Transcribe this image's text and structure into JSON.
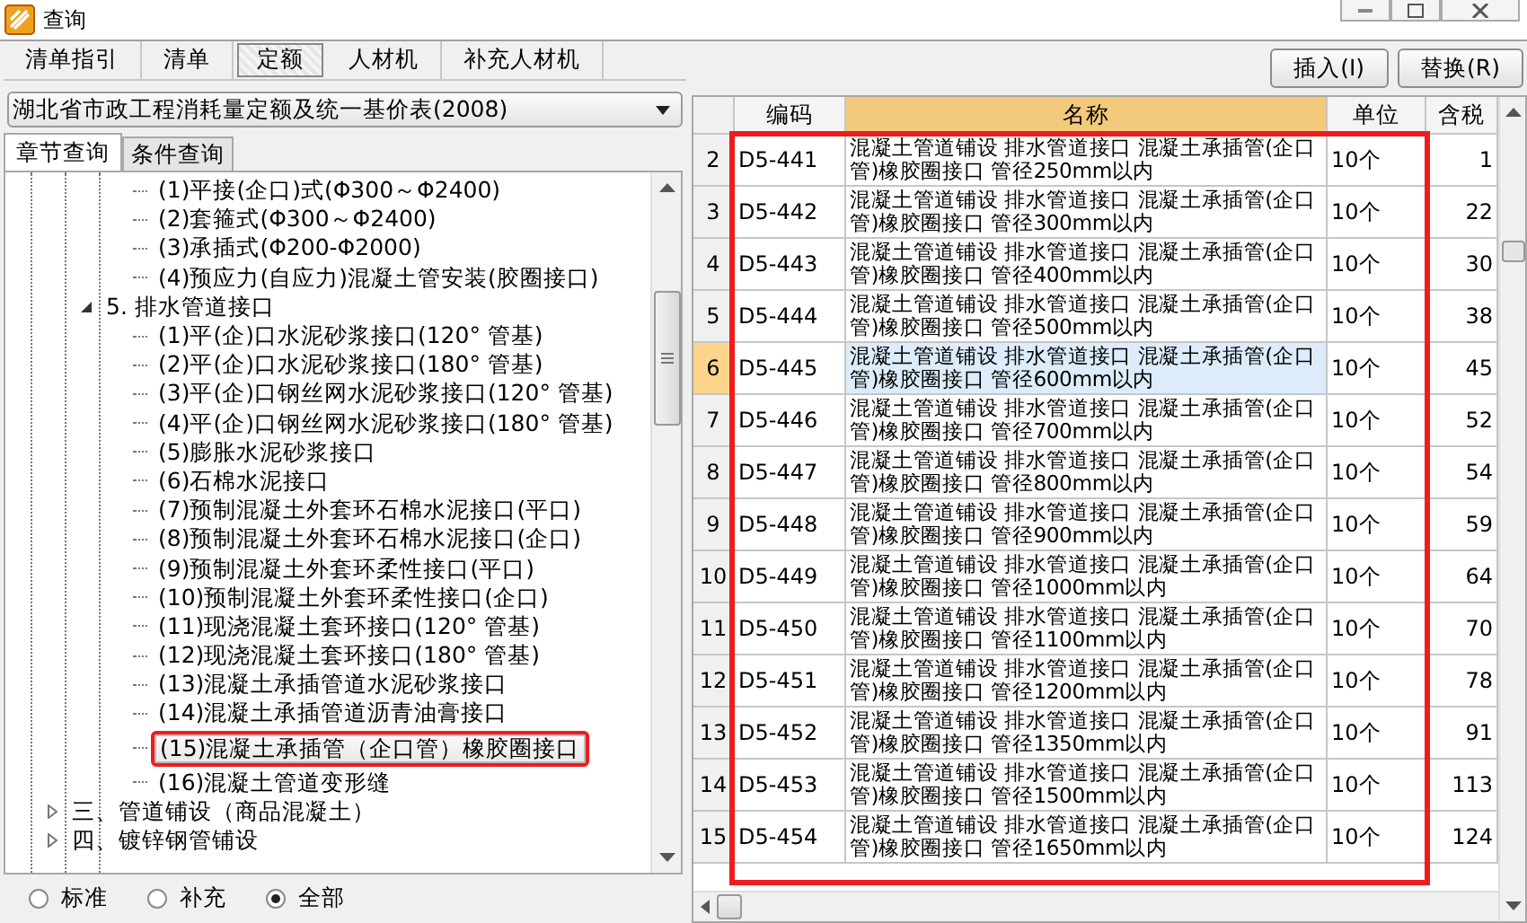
{
  "window": {
    "title": "查询"
  },
  "tabs": [
    {
      "label": "清单指引",
      "selected": false
    },
    {
      "label": "清单",
      "selected": false
    },
    {
      "label": "定额",
      "selected": true
    },
    {
      "label": "人材机",
      "selected": false
    },
    {
      "label": "补充人材机",
      "selected": false
    }
  ],
  "library_dropdown": {
    "value": "湖北省市政工程消耗量定额及统一基价表(2008)"
  },
  "query_tabs": [
    {
      "label": "章节查询",
      "selected": true
    },
    {
      "label": "条件查询",
      "selected": false
    }
  ],
  "tree": [
    {
      "children": [
        {
          "children": [
            {
              "label": "(1)平接(企口)式(Φ300～Φ2400)",
              "highlighted": false,
              "selected": false
            },
            {
              "label": "(2)套箍式(Φ300～Φ2400)",
              "highlighted": false,
              "selected": false
            },
            {
              "label": "(3)承插式(Φ200-Φ2000)",
              "highlighted": false,
              "selected": false
            },
            {
              "label": "(4)预应力(自应力)混凝土管安装(胶圈接口)",
              "highlighted": false,
              "selected": false
            }
          ]
        },
        {
          "label": "5. 排水管道接口",
          "highlighted": false,
          "selected": false,
          "expanded": true,
          "children": [
            {
              "label": "(1)平(企)口水泥砂浆接口(120° 管基)",
              "highlighted": false,
              "selected": false
            },
            {
              "label": "(2)平(企)口水泥砂浆接口(180° 管基)",
              "highlighted": false,
              "selected": false
            },
            {
              "label": "(3)平(企)口钢丝网水泥砂浆接口(120° 管基)",
              "highlighted": false,
              "selected": false
            },
            {
              "label": "(4)平(企)口钢丝网水泥砂浆接口(180° 管基)",
              "highlighted": false,
              "selected": false
            },
            {
              "label": "(5)膨胀水泥砂浆接口",
              "highlighted": false,
              "selected": false
            },
            {
              "label": "(6)石棉水泥接口",
              "highlighted": false,
              "selected": false
            },
            {
              "label": "(7)预制混凝土外套环石棉水泥接口(平口)",
              "highlighted": false,
              "selected": false
            },
            {
              "label": "(8)预制混凝土外套环石棉水泥接口(企口)",
              "highlighted": false,
              "selected": false
            },
            {
              "label": "(9)预制混凝土外套环柔性接口(平口)",
              "highlighted": false,
              "selected": false
            },
            {
              "label": "(10)预制混凝土外套环柔性接口(企口)",
              "highlighted": false,
              "selected": false
            },
            {
              "label": "(11)现浇混凝土套环接口(120° 管基)",
              "highlighted": false,
              "selected": false
            },
            {
              "label": "(12)现浇混凝土套环接口(180° 管基)",
              "highlighted": false,
              "selected": false
            },
            {
              "label": "(13)混凝土承插管道水泥砂浆接口",
              "highlighted": false,
              "selected": false
            },
            {
              "label": "(14)混凝土承插管道沥青油膏接口",
              "highlighted": false,
              "selected": false
            },
            {
              "label": "(15)混凝土承插管（企口管）橡胶圈接口",
              "highlighted": true,
              "selected": true
            },
            {
              "label": "(16)混凝土管道变形缝",
              "highlighted": false,
              "selected": false
            }
          ]
        }
      ]
    },
    {
      "label": "三、管道铺设（商品混凝土）",
      "highlighted": false,
      "selected": false,
      "expanded": false
    },
    {
      "label": "四、镀锌钢管铺设",
      "highlighted": false,
      "selected": false,
      "expanded": false
    }
  ],
  "filter_options": [
    {
      "label": "标准",
      "selected": false
    },
    {
      "label": "补充",
      "selected": false
    },
    {
      "label": "全部",
      "selected": true
    }
  ],
  "buttons": [
    "插入(I)",
    "替换(R)"
  ],
  "table": {
    "highlighted": true,
    "columns": [
      {
        "label": "编码",
        "selected": false
      },
      {
        "label": "名称",
        "selected": true
      },
      {
        "label": "单位",
        "selected": false
      },
      {
        "label": "含税",
        "selected": false
      }
    ],
    "rows": [
      {
        "number": "2",
        "code": "D5-441",
        "name": "混凝土管道铺设 排水管道接口 混凝土承插管(企口管)橡胶圈接口 管径250mm以内",
        "unit": "10个",
        "price": "1",
        "selected": false
      },
      {
        "number": "3",
        "code": "D5-442",
        "name": "混凝土管道铺设 排水管道接口 混凝土承插管(企口管)橡胶圈接口 管径300mm以内",
        "unit": "10个",
        "price": "22",
        "selected": false
      },
      {
        "number": "4",
        "code": "D5-443",
        "name": "混凝土管道铺设 排水管道接口 混凝土承插管(企口管)橡胶圈接口 管径400mm以内",
        "unit": "10个",
        "price": "30",
        "selected": false
      },
      {
        "number": "5",
        "code": "D5-444",
        "name": "混凝土管道铺设 排水管道接口 混凝土承插管(企口管)橡胶圈接口 管径500mm以内",
        "unit": "10个",
        "price": "38",
        "selected": false
      },
      {
        "number": "6",
        "code": "D5-445",
        "name": "混凝土管道铺设 排水管道接口 混凝土承插管(企口管)橡胶圈接口 管径600mm以内",
        "unit": "10个",
        "price": "45",
        "selected": true
      },
      {
        "number": "7",
        "code": "D5-446",
        "name": "混凝土管道铺设 排水管道接口 混凝土承插管(企口管)橡胶圈接口 管径700mm以内",
        "unit": "10个",
        "price": "52",
        "selected": false
      },
      {
        "number": "8",
        "code": "D5-447",
        "name": "混凝土管道铺设 排水管道接口 混凝土承插管(企口管)橡胶圈接口 管径800mm以内",
        "unit": "10个",
        "price": "54",
        "selected": false
      },
      {
        "number": "9",
        "code": "D5-448",
        "name": "混凝土管道铺设 排水管道接口 混凝土承插管(企口管)橡胶圈接口 管径900mm以内",
        "unit": "10个",
        "price": "59",
        "selected": false
      },
      {
        "number": "10",
        "code": "D5-449",
        "name": "混凝土管道铺设 排水管道接口 混凝土承插管(企口管)橡胶圈接口 管径1000mm以内",
        "unit": "10个",
        "price": "64",
        "selected": false
      },
      {
        "number": "11",
        "code": "D5-450",
        "name": "混凝土管道铺设 排水管道接口 混凝土承插管(企口管)橡胶圈接口 管径1100mm以内",
        "unit": "10个",
        "price": "70",
        "selected": false
      },
      {
        "number": "12",
        "code": "D5-451",
        "name": "混凝土管道铺设 排水管道接口 混凝土承插管(企口管)橡胶圈接口 管径1200mm以内",
        "unit": "10个",
        "price": "78",
        "selected": false
      },
      {
        "number": "13",
        "code": "D5-452",
        "name": "混凝土管道铺设 排水管道接口 混凝土承插管(企口管)橡胶圈接口 管径1350mm以内",
        "unit": "10个",
        "price": "91",
        "selected": false
      },
      {
        "number": "14",
        "code": "D5-453",
        "name": "混凝土管道铺设 排水管道接口 混凝土承插管(企口管)橡胶圈接口 管径1500mm以内",
        "unit": "10个",
        "price": "113",
        "selected": false
      },
      {
        "number": "15",
        "code": "D5-454",
        "name": "混凝土管道铺设 排水管道接口 混凝土承插管(企口管)橡胶圈接口 管径1650mm以内",
        "unit": "10个",
        "price": "124",
        "selected": false
      }
    ]
  }
}
